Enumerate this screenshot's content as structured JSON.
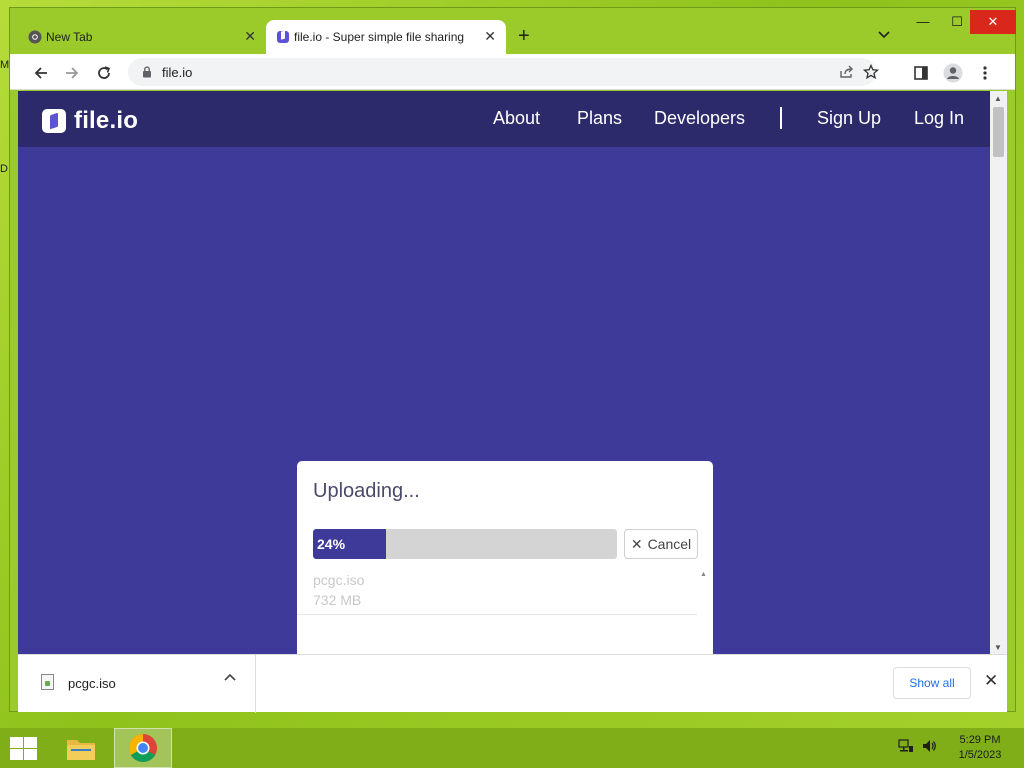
{
  "desktop": {
    "edge_letters": [
      "M",
      "D"
    ]
  },
  "browser": {
    "tabs": [
      {
        "title": "New Tab",
        "active": false,
        "favicon": "chrome-icon"
      },
      {
        "title": "file.io - Super simple file sharing",
        "active": true,
        "favicon": "fileio-icon"
      }
    ],
    "new_tab": "+",
    "tab_search": "⌄",
    "controls": {
      "minimize": "—",
      "maximize": "☐",
      "close": "✕"
    },
    "url": "file.io",
    "colors": {
      "frame": "#9acb2a",
      "close_red": "#d9271c"
    }
  },
  "site": {
    "logo_text": "file.io",
    "nav": {
      "about": "About",
      "plans": "Plans",
      "developers": "Developers",
      "sign_up": "Sign Up",
      "log_in": "Log In"
    },
    "colors": {
      "header": "#2c2a6b",
      "background": "#3d3a99",
      "accent": "#3d3a99"
    }
  },
  "upload": {
    "title": "Uploading...",
    "progress_label": "24%",
    "progress_fraction": 0.24,
    "cancel_label": "Cancel",
    "cancel_icon": "✕",
    "files": [
      {
        "name": "pcgc.iso",
        "size": "732 MB"
      }
    ]
  },
  "downloads": {
    "items": [
      {
        "name": "pcgc.iso"
      }
    ],
    "show_all": "Show all",
    "close": "✕"
  },
  "taskbar": {
    "time": "5:29 PM",
    "date": "1/5/2023"
  }
}
